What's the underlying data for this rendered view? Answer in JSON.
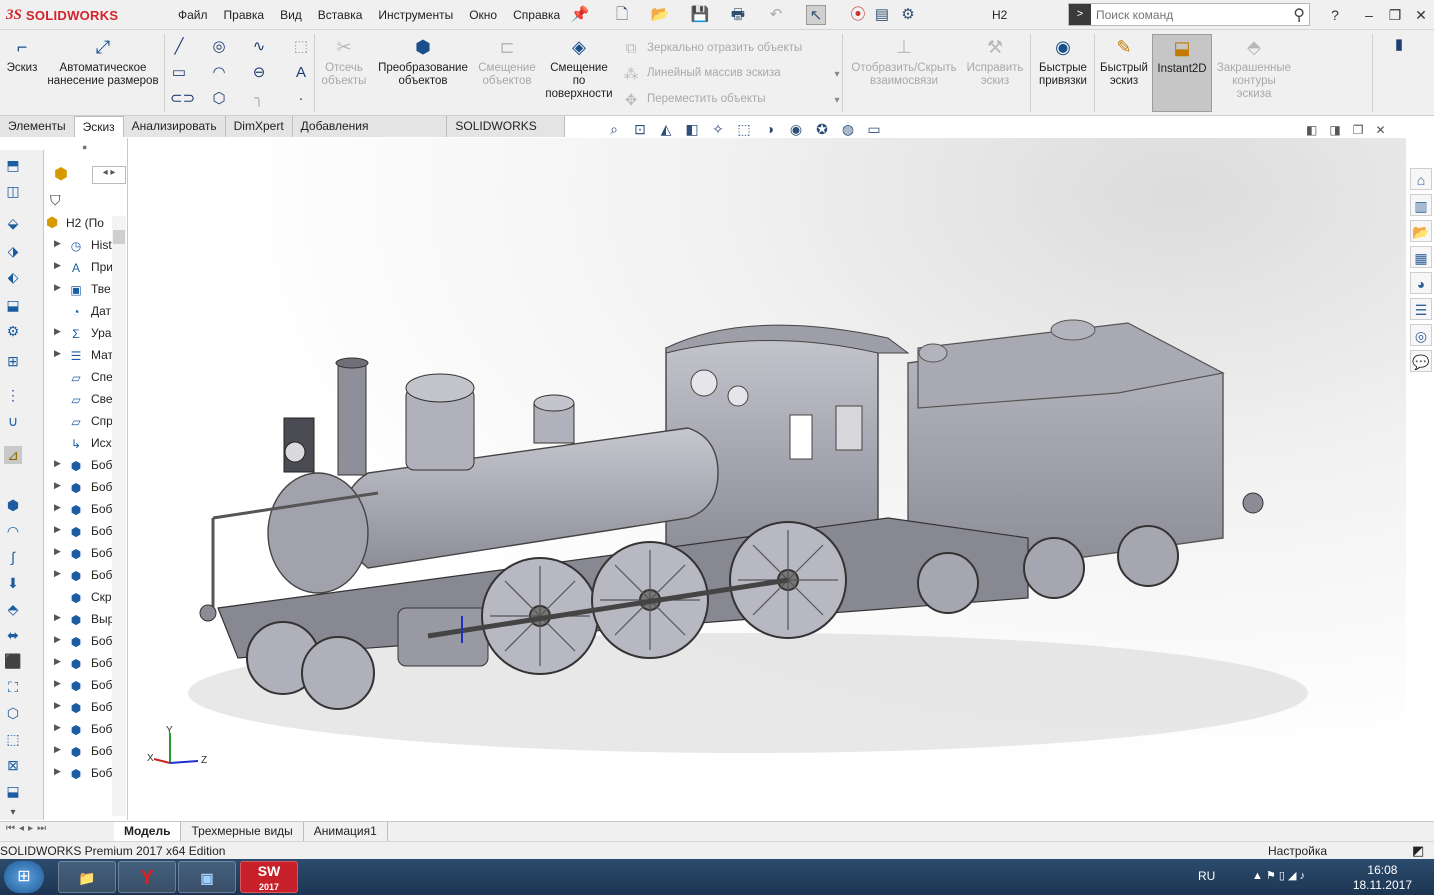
{
  "app": {
    "brand_ds": "3S",
    "brand_name": "SOLIDWORKS",
    "menu": [
      "Файл",
      "Правка",
      "Вид",
      "Вставка",
      "Инструменты",
      "Окно",
      "Справка"
    ],
    "document_title": "H2",
    "search_placeholder": "Поиск команд"
  },
  "ribbon": {
    "sketch": "Эскиз",
    "smart_dim_l1": "Автоматическое",
    "smart_dim_l2": "нанесение размеров",
    "trim_l1": "Отсечь",
    "trim_l2": "объекты",
    "convert_l1": "Преобразование",
    "convert_l2": "объектов",
    "offset_l1": "Смещение",
    "offset_l2": "объектов",
    "offset_surf_l1": "Смещение",
    "offset_surf_l2": "по",
    "offset_surf_l3": "поверхности",
    "mirror": "Зеркально отразить объекты",
    "linear_pattern": "Линейный массив эскиза",
    "move": "Переместить объекты",
    "display_rel_l1": "Отобразить/Скрыть",
    "display_rel_l2": "взаимосвязи",
    "repair_l1": "Исправить",
    "repair_l2": "эскиз",
    "quick_snaps_l1": "Быстрые",
    "quick_snaps_l2": "привязки",
    "rapid_l1": "Быстрый",
    "rapid_l2": "эскиз",
    "instant2d": "Instant2D",
    "shaded_l1": "Закрашенные",
    "shaded_l2": "контуры",
    "shaded_l3": "эскиза"
  },
  "tabs": [
    {
      "label": "Элементы",
      "active": false
    },
    {
      "label": "Эскиз",
      "active": true
    },
    {
      "label": "Анализировать",
      "active": false
    },
    {
      "label": "DimXpert",
      "active": false
    },
    {
      "label": "Добавления SOLIDWORKS",
      "active": false
    },
    {
      "label": "SOLIDWORKS MBD",
      "active": false
    }
  ],
  "tree": {
    "root": "H2  (По",
    "items": [
      {
        "label": "Hist",
        "icon": "history-icon"
      },
      {
        "label": "При",
        "icon": "annotations-icon"
      },
      {
        "label": "Тве",
        "icon": "solid-bodies-icon"
      },
      {
        "label": "Дат",
        "icon": "sensors-icon"
      },
      {
        "label": "Ура",
        "icon": "equations-icon"
      },
      {
        "label": "Мат",
        "icon": "mates-icon"
      },
      {
        "label": "Спе",
        "icon": "plane-icon"
      },
      {
        "label": "Све",
        "icon": "plane-icon"
      },
      {
        "label": "Спр",
        "icon": "plane-icon"
      },
      {
        "label": "Исх",
        "icon": "origin-icon"
      },
      {
        "label": "Боб",
        "icon": "part-icon"
      },
      {
        "label": "Боб",
        "icon": "part-icon"
      },
      {
        "label": "Боб",
        "icon": "part-icon"
      },
      {
        "label": "Боб",
        "icon": "part-icon"
      },
      {
        "label": "Боб",
        "icon": "part-icon"
      },
      {
        "label": "Боб",
        "icon": "part-icon"
      },
      {
        "label": "Скр",
        "icon": "part-icon"
      },
      {
        "label": "Выр",
        "icon": "part-icon"
      },
      {
        "label": "Боб",
        "icon": "part-icon"
      },
      {
        "label": "Боб",
        "icon": "part-icon"
      },
      {
        "label": "Боб",
        "icon": "part-icon"
      },
      {
        "label": "Боб",
        "icon": "part-icon"
      },
      {
        "label": "Боб",
        "icon": "part-icon"
      },
      {
        "label": "Боб",
        "icon": "part-icon"
      },
      {
        "label": "Боб",
        "icon": "part-icon"
      }
    ]
  },
  "triad": {
    "x": "X",
    "y": "Y",
    "z": "Z"
  },
  "bottom_tabs": [
    {
      "label": "Модель",
      "active": true
    },
    {
      "label": "Трехмерные виды",
      "active": false
    },
    {
      "label": "Анимация1",
      "active": false
    }
  ],
  "status": {
    "edition": "SOLIDWORKS Premium 2017 x64 Edition",
    "custom": "Настройка"
  },
  "taskbar": {
    "lang": "RU",
    "time": "16:08",
    "date": "18.11.2017",
    "sw_label": "SW",
    "sw_year": "2017"
  },
  "colors": {
    "accent": "#d2232a",
    "model_gray": "#9a9aa4",
    "selected_tool": "#c6c6c6"
  }
}
